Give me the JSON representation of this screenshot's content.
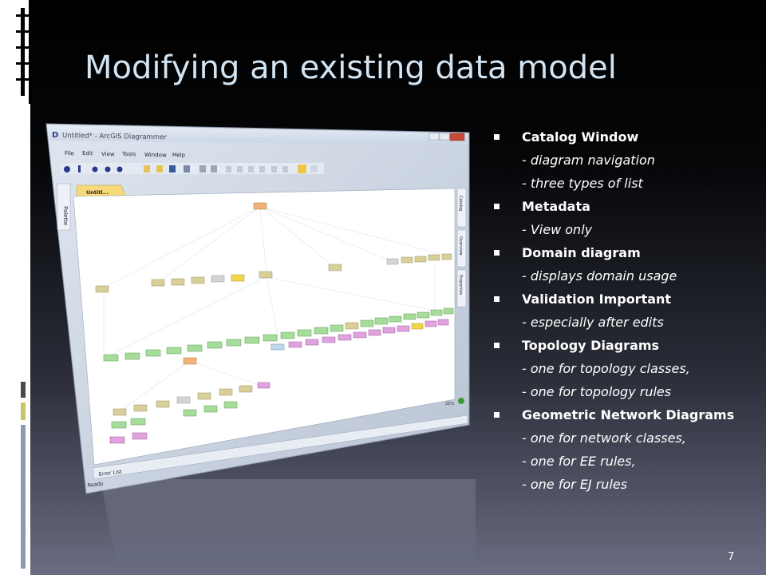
{
  "slide": {
    "title": "Modifying an existing data model",
    "page_number": "7"
  },
  "bullets": [
    {
      "type": "head",
      "text": "Catalog Window"
    },
    {
      "type": "sub",
      "text": "- diagram navigation"
    },
    {
      "type": "sub",
      "text": "- three types of  list"
    },
    {
      "type": "head",
      "text": "Metadata"
    },
    {
      "type": "sub",
      "text": "- View only"
    },
    {
      "type": "head",
      "text": "Domain diagram"
    },
    {
      "type": "sub",
      "text": "- displays domain usage"
    },
    {
      "type": "head",
      "text": "Validation Important"
    },
    {
      "type": "sub",
      "text": "- especially after edits"
    },
    {
      "type": "head",
      "text": "Topology Diagrams"
    },
    {
      "type": "sub",
      "text": "- one for topology classes,"
    },
    {
      "type": "sub",
      "text": "- one for topology rules"
    },
    {
      "type": "head",
      "text": "Geometric Network Diagrams"
    },
    {
      "type": "sub",
      "text": "- one for network classes,"
    },
    {
      "type": "sub",
      "text": "- one for EE rules,"
    },
    {
      "type": "sub",
      "text": "- one for EJ rules"
    }
  ],
  "app": {
    "window_title": "Untitled* - ArcGIS Diagrammer",
    "menu": [
      "File",
      "Edit",
      "View",
      "Tools",
      "Window",
      "Help"
    ],
    "doc_tab": "Untitl...",
    "palette_tab": "Palette",
    "side_tabs": [
      "Catalog",
      "Overview",
      "Properties"
    ],
    "zoom": "25%",
    "error_tab": "Error List",
    "status": "Ready"
  },
  "colors": {
    "title": "#d2e4f2",
    "node_tan": "#d9cf9a",
    "node_green": "#a6dd9a",
    "node_pink": "#e0a3e0",
    "node_gray": "#d4d4d4",
    "node_orange": "#f0b27a",
    "node_yellow": "#f2d64a",
    "node_blue": "#c0d8ee"
  }
}
